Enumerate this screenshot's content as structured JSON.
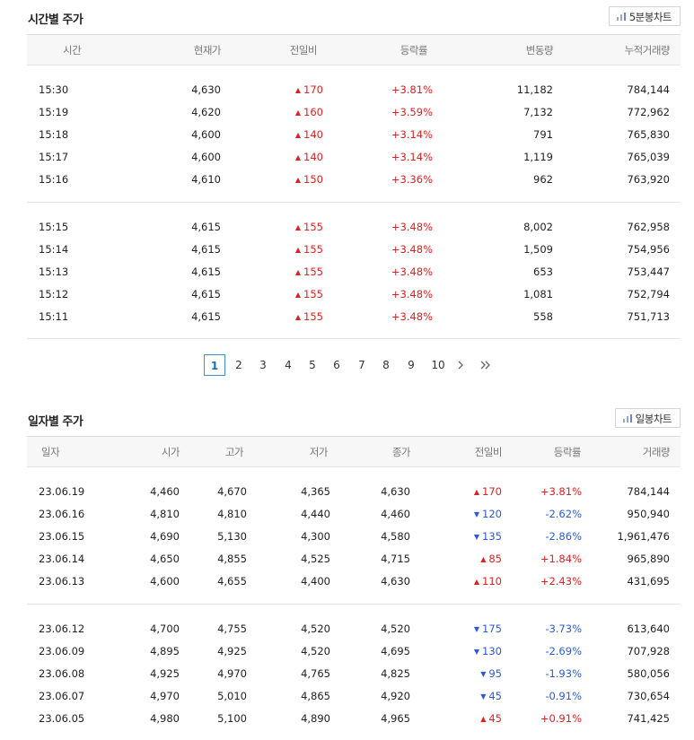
{
  "time_section": {
    "title": "시간별 주가",
    "chart_button": "5분봉차트",
    "columns": [
      "시간",
      "현재가",
      "전일비",
      "등락률",
      "변동량",
      "누적거래량"
    ],
    "groups": [
      [
        {
          "time": "15:30",
          "price": "4,630",
          "change": "170",
          "dir": "up",
          "rate": "+3.81%",
          "vol": "11,182",
          "cum": "784,144"
        },
        {
          "time": "15:19",
          "price": "4,620",
          "change": "160",
          "dir": "up",
          "rate": "+3.59%",
          "vol": "7,132",
          "cum": "772,962"
        },
        {
          "time": "15:18",
          "price": "4,600",
          "change": "140",
          "dir": "up",
          "rate": "+3.14%",
          "vol": "791",
          "cum": "765,830"
        },
        {
          "time": "15:17",
          "price": "4,600",
          "change": "140",
          "dir": "up",
          "rate": "+3.14%",
          "vol": "1,119",
          "cum": "765,039"
        },
        {
          "time": "15:16",
          "price": "4,610",
          "change": "150",
          "dir": "up",
          "rate": "+3.36%",
          "vol": "962",
          "cum": "763,920"
        }
      ],
      [
        {
          "time": "15:15",
          "price": "4,615",
          "change": "155",
          "dir": "up",
          "rate": "+3.48%",
          "vol": "8,002",
          "cum": "762,958"
        },
        {
          "time": "15:14",
          "price": "4,615",
          "change": "155",
          "dir": "up",
          "rate": "+3.48%",
          "vol": "1,509",
          "cum": "754,956"
        },
        {
          "time": "15:13",
          "price": "4,615",
          "change": "155",
          "dir": "up",
          "rate": "+3.48%",
          "vol": "653",
          "cum": "753,447"
        },
        {
          "time": "15:12",
          "price": "4,615",
          "change": "155",
          "dir": "up",
          "rate": "+3.48%",
          "vol": "1,081",
          "cum": "752,794"
        },
        {
          "time": "15:11",
          "price": "4,615",
          "change": "155",
          "dir": "up",
          "rate": "+3.48%",
          "vol": "558",
          "cum": "751,713"
        }
      ]
    ]
  },
  "pagination": {
    "current": "1",
    "pages": [
      "1",
      "2",
      "3",
      "4",
      "5",
      "6",
      "7",
      "8",
      "9",
      "10"
    ]
  },
  "daily_section": {
    "title": "일자별 주가",
    "chart_button": "일봉차트",
    "columns": [
      "일자",
      "시가",
      "고가",
      "저가",
      "종가",
      "전일비",
      "등락률",
      "거래량"
    ],
    "groups": [
      [
        {
          "date": "23.06.19",
          "open": "4,460",
          "high": "4,670",
          "low": "4,365",
          "close": "4,630",
          "change": "170",
          "dir": "up",
          "rate": "+3.81%",
          "vol": "784,144"
        },
        {
          "date": "23.06.16",
          "open": "4,810",
          "high": "4,810",
          "low": "4,440",
          "close": "4,460",
          "change": "120",
          "dir": "down",
          "rate": "-2.62%",
          "vol": "950,940"
        },
        {
          "date": "23.06.15",
          "open": "4,690",
          "high": "5,130",
          "low": "4,300",
          "close": "4,580",
          "change": "135",
          "dir": "down",
          "rate": "-2.86%",
          "vol": "1,961,476"
        },
        {
          "date": "23.06.14",
          "open": "4,650",
          "high": "4,855",
          "low": "4,525",
          "close": "4,715",
          "change": "85",
          "dir": "up",
          "rate": "+1.84%",
          "vol": "965,890"
        },
        {
          "date": "23.06.13",
          "open": "4,600",
          "high": "4,655",
          "low": "4,400",
          "close": "4,630",
          "change": "110",
          "dir": "up",
          "rate": "+2.43%",
          "vol": "431,695"
        }
      ],
      [
        {
          "date": "23.06.12",
          "open": "4,700",
          "high": "4,755",
          "low": "4,520",
          "close": "4,520",
          "change": "175",
          "dir": "down",
          "rate": "-3.73%",
          "vol": "613,640"
        },
        {
          "date": "23.06.09",
          "open": "4,895",
          "high": "4,925",
          "low": "4,520",
          "close": "4,695",
          "change": "130",
          "dir": "down",
          "rate": "-2.69%",
          "vol": "707,928"
        },
        {
          "date": "23.06.08",
          "open": "4,925",
          "high": "4,970",
          "low": "4,765",
          "close": "4,825",
          "change": "95",
          "dir": "down",
          "rate": "-1.93%",
          "vol": "580,056"
        },
        {
          "date": "23.06.07",
          "open": "4,970",
          "high": "5,010",
          "low": "4,865",
          "close": "4,920",
          "change": "45",
          "dir": "down",
          "rate": "-0.91%",
          "vol": "730,654"
        },
        {
          "date": "23.06.05",
          "open": "4,980",
          "high": "5,100",
          "low": "4,890",
          "close": "4,965",
          "change": "45",
          "dir": "up",
          "rate": "+0.91%",
          "vol": "741,425"
        }
      ]
    ]
  },
  "colors": {
    "up": "#e02020",
    "down": "#2a5bd7",
    "pager_active": "#3a8fd9"
  },
  "icons": {
    "chart": "bar-chart-icon",
    "next": "chevron-right-icon",
    "last": "double-chevron-right-icon",
    "up": "triangle-up-icon",
    "down": "triangle-down-icon"
  }
}
